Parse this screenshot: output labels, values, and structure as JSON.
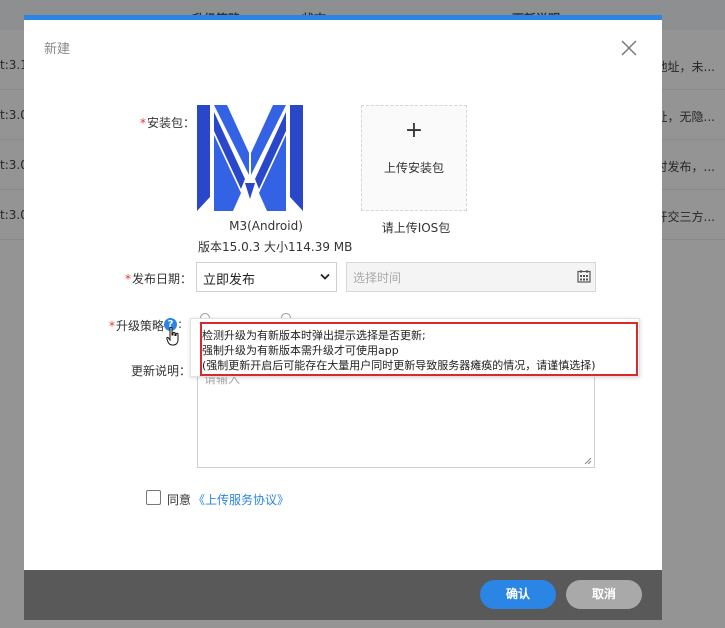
{
  "background": {
    "headers": [
      "升级策略",
      "状态",
      "更新说明"
    ],
    "rows": [
      {
        "left": "t:3.1",
        "right": "地址，未..."
      },
      {
        "left": "t:3.0.",
        "right": "址，无隐..."
      },
      {
        "left": "t:3.0.",
        "right": "时发布，..."
      },
      {
        "left": "t:3.0.",
        "right": "开交三方..."
      }
    ]
  },
  "modal": {
    "title": "新建",
    "package": {
      "label": "安装包",
      "app_name": "M3(Android)",
      "app_version_size": "版本15.0.3 大小114.39 MB",
      "upload_plus": "+",
      "upload_text": "上传安装包",
      "ios_hint": "请上传IOS包"
    },
    "publish_date": {
      "label": "发布日期",
      "selected": "立即发布",
      "time_placeholder": "选择时间"
    },
    "strategy": {
      "label": "升级策略",
      "help_glyph": "?",
      "tooltip": [
        "检测升级为有新版本时弹出提示选择是否更新;",
        "强制升级为有新版本需升级才可使用app",
        "(强制更新开启后可能存在大量用户同时更新导致服务器瘫痪的情况，请谨慎选择)"
      ]
    },
    "notes": {
      "label": "更新说明",
      "placeholder": "请输入"
    },
    "agree": {
      "label": "同意",
      "link": "《上传服务协议》"
    },
    "footer": {
      "confirm": "确认",
      "cancel": "取消"
    }
  },
  "colors": {
    "accent": "#2b85e4",
    "highlight_border": "#d9292a",
    "required": "#e33333"
  }
}
